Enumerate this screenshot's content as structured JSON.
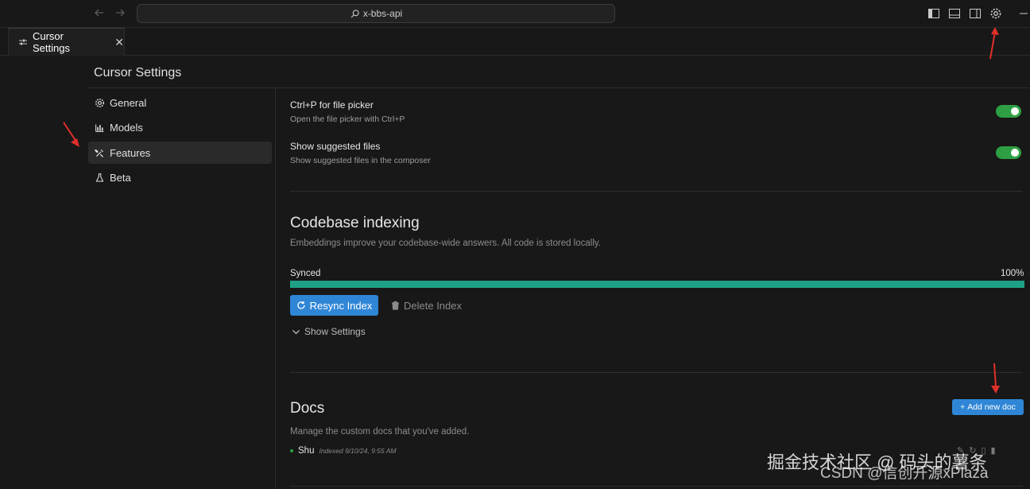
{
  "titlebar": {
    "search_text": "x-bbs-api",
    "icons": [
      "back-arrow-icon",
      "forward-arrow-icon",
      "search-icon",
      "toggle-primary-sidebar-icon",
      "toggle-panel-icon",
      "toggle-secondary-sidebar-icon",
      "settings-gear-icon",
      "minimize-icon"
    ]
  },
  "tab": {
    "label": "Cursor Settings",
    "close": "✕"
  },
  "settings": {
    "title": "Cursor Settings",
    "sidebar": [
      {
        "label": "General",
        "icon": "gear-icon"
      },
      {
        "label": "Models",
        "icon": "bar-chart-icon"
      },
      {
        "label": "Features",
        "icon": "tools-icon",
        "active": true
      },
      {
        "label": "Beta",
        "icon": "flask-icon"
      }
    ]
  },
  "features": {
    "rows": [
      {
        "title": "Ctrl+P for file picker",
        "subtitle": "Open the file picker with Ctrl+P",
        "enabled": true
      },
      {
        "title": "Show suggested files",
        "subtitle": "Show suggested files in the composer",
        "enabled": true
      }
    ],
    "codebase": {
      "title": "Codebase indexing",
      "subtitle": "Embeddings improve your codebase-wide answers. All code is stored locally.",
      "status": "Synced",
      "percent_text": "100%",
      "progress": 1.0,
      "resync_label": "Resync Index",
      "delete_label": "Delete Index",
      "show_settings_label": "Show Settings"
    },
    "docs": {
      "title": "Docs",
      "subtitle": "Manage the custom docs that you've added.",
      "add_label": "Add new doc",
      "items": [
        {
          "name": "Shu",
          "meta": "Indexed 9/10/24, 9:55 AM"
        }
      ]
    }
  },
  "watermark": {
    "line1": "掘金技术社区 @ 码头的薯条",
    "line2": "CSDN @信创开源xPlaza"
  },
  "colors": {
    "accent_blue": "#2f86d6",
    "progress_green": "#1fa187",
    "toggle_green": "#2ea043",
    "annotation_red": "#e0302a"
  }
}
